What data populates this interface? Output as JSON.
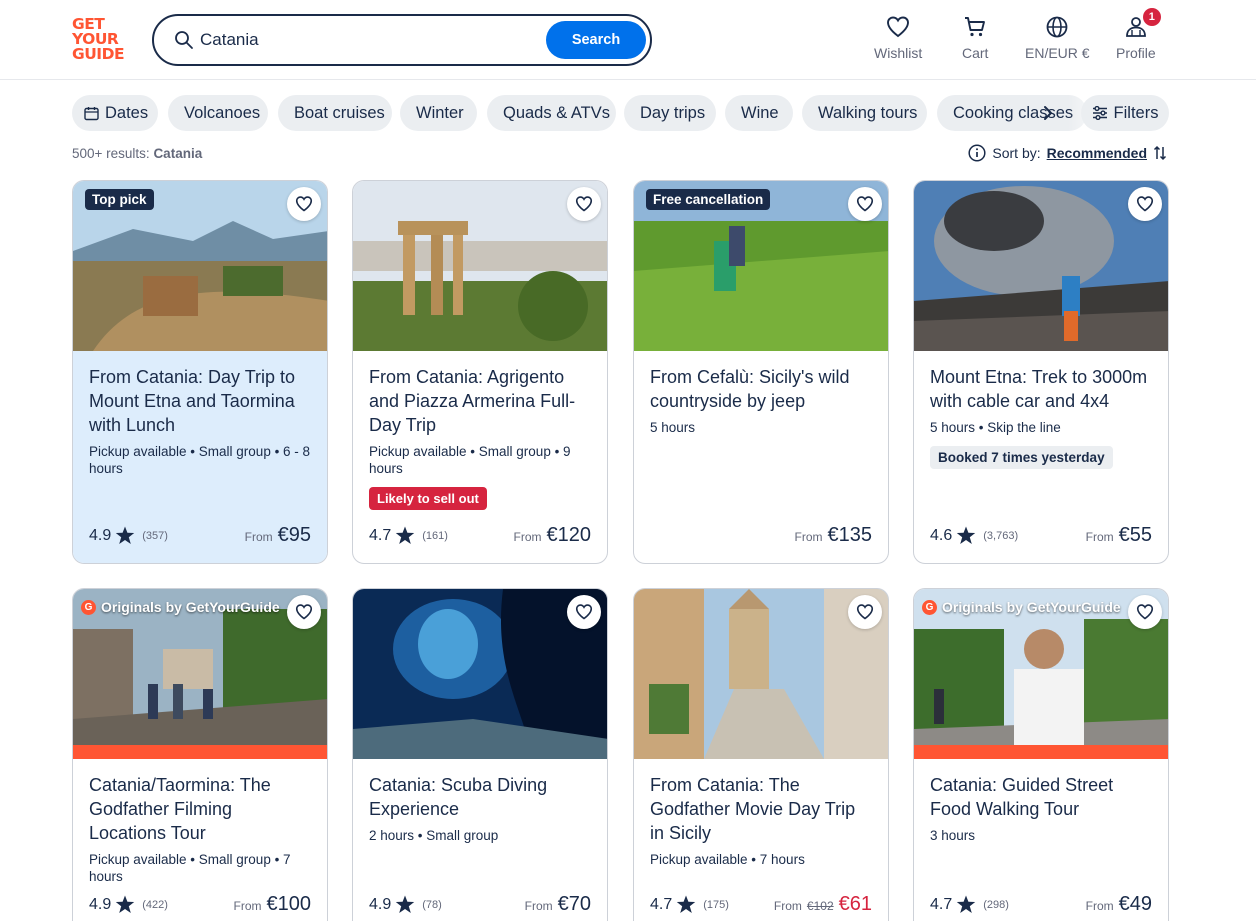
{
  "brand": {
    "logo_lines": [
      "GET",
      "YOUR",
      "GUIDE"
    ],
    "color": "#ff5533"
  },
  "search": {
    "value": "Catania",
    "button_label": "Search"
  },
  "nav": {
    "wishlist": "Wishlist",
    "cart": "Cart",
    "language": "EN/EUR €",
    "profile": "Profile",
    "profile_badge": "1"
  },
  "chips": [
    "Dates",
    "Volcanoes",
    "Boat cruises",
    "Winter",
    "Quads & ATVs",
    "Day trips",
    "Wine",
    "Walking tours",
    "Cooking classes"
  ],
  "filters_label": "Filters",
  "results": {
    "count": "500+ results:",
    "query": "Catania"
  },
  "sort": {
    "label": "Sort by:",
    "value": "Recommended"
  },
  "colors": {
    "primary": "#0071eb",
    "text": "#1a2b49",
    "danger": "#d6243f",
    "highlight": "#ddedfc"
  },
  "cards": [
    {
      "tag": "Top pick",
      "title": "From Catania: Day Trip to Mount Etna and Taormina with Lunch",
      "meta": "Pickup available • Small group • 6 - 8 hours",
      "rating": "4.9",
      "reviews": "(357)",
      "from": "From",
      "price": "€95"
    },
    {
      "title": "From Catania: Agrigento and Piazza Armerina Full-Day Trip",
      "meta": "Pickup available • Small group • 9 hours",
      "pill": "Likely to sell out",
      "rating": "4.7",
      "reviews": "(161)",
      "from": "From",
      "price": "€120"
    },
    {
      "tag": "Free cancellation",
      "title": "From Cefalù: Sicily's wild countryside by jeep",
      "meta": "5 hours",
      "from": "From",
      "price": "€135"
    },
    {
      "title": "Mount Etna: Trek to 3000m with cable car and 4x4",
      "meta": "5 hours • Skip the line",
      "pill": "Booked 7 times yesterday",
      "rating": "4.6",
      "reviews": "(3,763)",
      "from": "From",
      "price": "€55"
    },
    {
      "originals": "Originals by GetYourGuide",
      "title": "Catania/Taormina: The Godfather Filming Locations Tour",
      "meta": "Pickup available • Small group • 7 hours",
      "rating": "4.9",
      "reviews": "(422)",
      "from": "From",
      "price": "€100"
    },
    {
      "title": "Catania: Scuba Diving Experience",
      "meta": "2 hours • Small group",
      "rating": "4.9",
      "reviews": "(78)",
      "from": "From",
      "price": "€70"
    },
    {
      "title": "From Catania: The Godfather Movie Day Trip in Sicily",
      "meta": "Pickup available • 7 hours",
      "rating": "4.7",
      "reviews": "(175)",
      "from": "From",
      "old_price": "€102",
      "price": "€61"
    },
    {
      "originals": "Originals by GetYourGuide",
      "title": "Catania: Guided Street Food Walking Tour",
      "meta": "3 hours",
      "rating": "4.7",
      "reviews": "(298)",
      "from": "From",
      "price": "€49"
    }
  ]
}
